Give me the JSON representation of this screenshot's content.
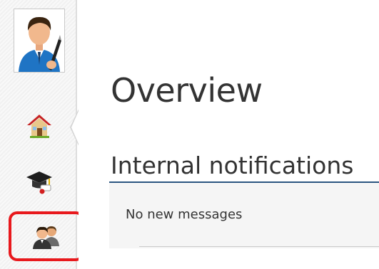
{
  "sidebar": {
    "avatar": {
      "icon": "user-with-pen-icon"
    },
    "items": [
      {
        "key": "home",
        "icon": "home-icon",
        "active": true
      },
      {
        "key": "training",
        "icon": "graduation-cap-icon",
        "active": false
      },
      {
        "key": "people",
        "icon": "people-icon",
        "active": false,
        "highlighted": true
      }
    ]
  },
  "main": {
    "title": "Overview",
    "section": {
      "title": "Internal notifications",
      "empty_message": "No new messages"
    }
  },
  "colors": {
    "accent_line": "#2b5580",
    "highlight": "#e8191d",
    "text": "#333333",
    "panel_bg": "#f5f5f5",
    "sidebar_bg": "#f1f1f1"
  }
}
